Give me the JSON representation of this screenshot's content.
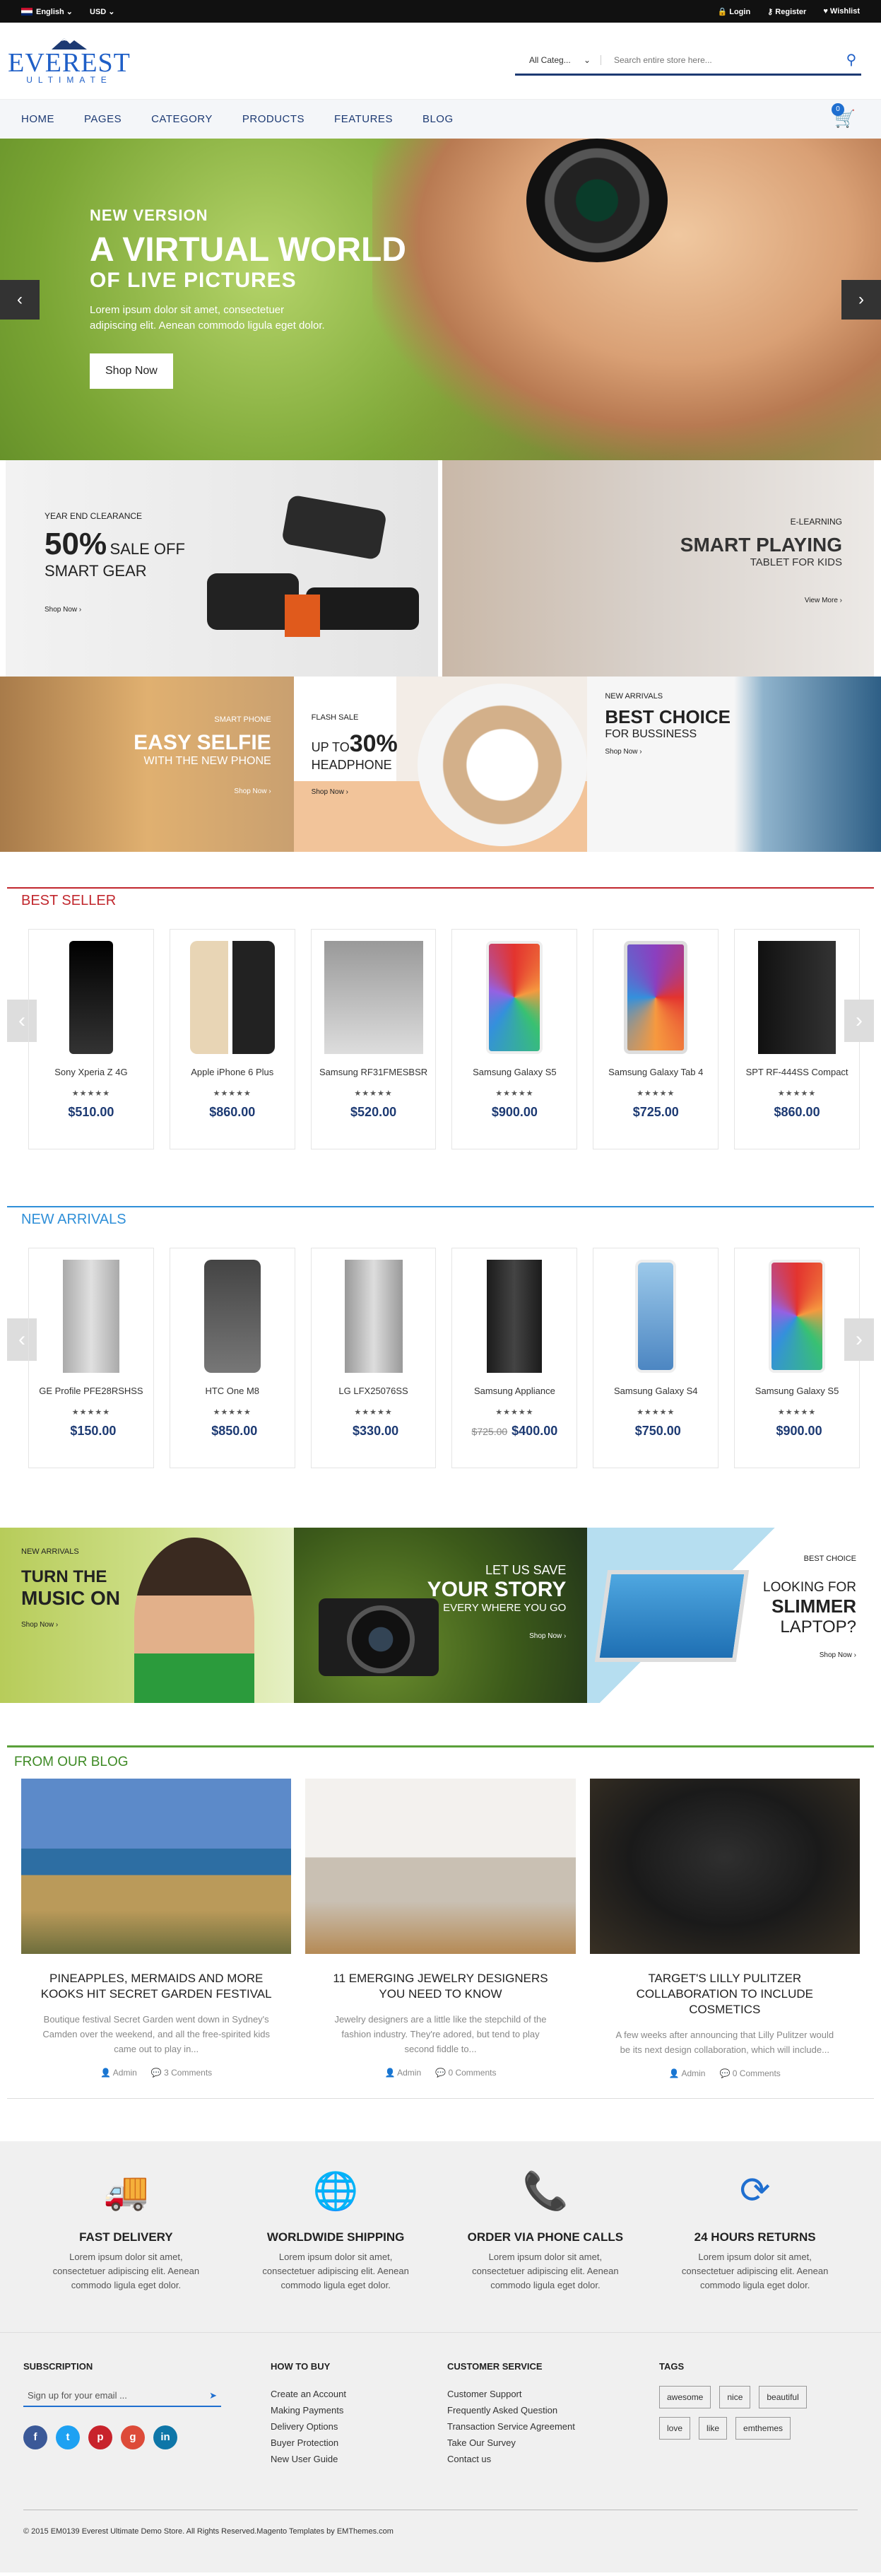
{
  "topbar": {
    "language": "English",
    "currency": "USD",
    "login": "Login",
    "register": "Register",
    "wishlist": "Wishlist"
  },
  "logo": {
    "name": "EVEREST",
    "tagline": "ULTIMATE"
  },
  "search": {
    "category": "All Categ...",
    "placeholder": "Search entire store here..."
  },
  "nav": {
    "items": [
      "HOME",
      "PAGES",
      "CATEGORY",
      "PRODUCTS",
      "FEATURES",
      "BLOG"
    ],
    "cart_count": "0"
  },
  "hero": {
    "kicker": "NEW VERSION",
    "title": "A VIRTUAL WORLD",
    "subtitle": "OF LIVE PICTURES",
    "text": "Lorem ipsum dolor sit amet, consectetuer adipiscing elit. Aenean commodo ligula eget dolor.",
    "button": "Shop Now"
  },
  "promo1": {
    "kicker": "YEAR END CLEARANCE",
    "percent": "50%",
    "sale": "SALE OFF",
    "product": "SMART GEAR",
    "shop": "Shop Now ›"
  },
  "promo2": {
    "kicker": "E-LEARNING",
    "title": "SMART PLAYING",
    "subtitle": "TABLET FOR KIDS",
    "shop": "View More ›"
  },
  "promo3": {
    "kicker": "SMART PHONE",
    "title": "EASY SELFIE",
    "subtitle": "WITH THE NEW PHONE",
    "shop": "Shop Now ›"
  },
  "promo4": {
    "kicker": "FLASH SALE",
    "upto": "UP TO",
    "percent": "30%",
    "product": "HEADPHONE",
    "shop": "Shop Now ›"
  },
  "promo5": {
    "kicker": "NEW ARRIVALS",
    "title": "BEST CHOICE",
    "subtitle": "FOR BUSSINESS",
    "shop": "Shop Now ›"
  },
  "bestseller": {
    "title": "BEST SELLER",
    "products": [
      {
        "name": "Sony Xperia Z 4G",
        "price": "$510.00",
        "stars": "★★★★★"
      },
      {
        "name": "Apple iPhone 6 Plus",
        "price": "$860.00",
        "stars": "★★★★★"
      },
      {
        "name": "Samsung RF31FMESBSR",
        "price": "$520.00",
        "stars": "★★★★★"
      },
      {
        "name": "Samsung Galaxy S5",
        "price": "$900.00",
        "stars": "★★★★★"
      },
      {
        "name": "Samsung Galaxy Tab 4",
        "price": "$725.00",
        "stars": "★★★★★"
      },
      {
        "name": "SPT RF-444SS Compact",
        "price": "$860.00",
        "stars": "★★★★★"
      }
    ]
  },
  "newarrivals": {
    "title": "NEW ARRIVALS",
    "products": [
      {
        "name": "GE Profile PFE28RSHSS",
        "price": "$150.00",
        "stars": "★★★★★",
        "old": ""
      },
      {
        "name": "HTC One M8",
        "price": "$850.00",
        "stars": "★★★★★",
        "old": ""
      },
      {
        "name": "LG LFX25076SS",
        "price": "$330.00",
        "stars": "★★★★★",
        "old": ""
      },
      {
        "name": "Samsung Appliance",
        "price": "$400.00",
        "stars": "★★★★★",
        "old": "$725.00"
      },
      {
        "name": "Samsung Galaxy S4",
        "price": "$750.00",
        "stars": "★★★★★",
        "old": ""
      },
      {
        "name": "Samsung Galaxy S5",
        "price": "$900.00",
        "stars": "★★★★★",
        "old": ""
      }
    ]
  },
  "promo6": {
    "kicker": "NEW ARRIVALS",
    "title": "TURN THE",
    "title2": "MUSIC ON",
    "shop": "Shop Now ›"
  },
  "promo7": {
    "kicker": "LET US SAVE",
    "title": "YOUR STORY",
    "subtitle": "EVERY WHERE YOU GO",
    "shop": "Shop Now ›"
  },
  "promo8": {
    "kicker": "BEST CHOICE",
    "title": "LOOKING FOR",
    "title2": "SLIMMER",
    "title3": "LAPTOP?",
    "shop": "Shop Now ›"
  },
  "blog": {
    "title": "FROM OUR BLOG",
    "posts": [
      {
        "title": "PINEAPPLES, MERMAIDS AND MORE KOOKS HIT SECRET GARDEN FESTIVAL",
        "excerpt": "Boutique festival Secret Garden went down in Sydney's Camden over the weekend, and all the free-spirited kids came out to play in...",
        "author": "Admin",
        "comments": "3 Comments"
      },
      {
        "title": "11 EMERGING JEWELRY DESIGNERS YOU NEED TO KNOW",
        "excerpt": "Jewelry designers are a little like the stepchild of the fashion industry. They're adored, but tend to play second fiddle to...",
        "author": "Admin",
        "comments": "0 Comments"
      },
      {
        "title": "TARGET'S LILLY PULITZER COLLABORATION TO INCLUDE COSMETICS",
        "excerpt": "A few weeks after announcing that Lilly Pulitzer would be its next design collaboration, which will include...",
        "author": "Admin",
        "comments": "0 Comments"
      }
    ]
  },
  "features": [
    {
      "title": "FAST DELIVERY",
      "text": "Lorem ipsum dolor sit amet, consectetuer adipiscing elit. Aenean commodo ligula eget dolor.",
      "icon": "truck-icon"
    },
    {
      "title": "WORLDWIDE SHIPPING",
      "text": "Lorem ipsum dolor sit amet, consectetuer adipiscing elit. Aenean commodo ligula eget dolor.",
      "icon": "globe-icon"
    },
    {
      "title": "ORDER VIA PHONE CALLS",
      "text": "Lorem ipsum dolor sit amet, consectetuer adipiscing elit. Aenean commodo ligula eget dolor.",
      "icon": "phone-icon"
    },
    {
      "title": "24 HOURS RETURNS",
      "text": "Lorem ipsum dolor sit amet, consectetuer adipiscing elit. Aenean commodo ligula eget dolor.",
      "icon": "24h-icon"
    }
  ],
  "footer": {
    "subscription": {
      "title": "SUBSCRIPTION",
      "placeholder": "Sign up for your email ..."
    },
    "howtobuy": {
      "title": "HOW TO BUY",
      "links": [
        "Create an Account",
        "Making Payments",
        "Delivery Options",
        "Buyer Protection",
        "New User Guide"
      ]
    },
    "service": {
      "title": "CUSTOMER SERVICE",
      "links": [
        "Customer Support",
        "Frequently Asked Question",
        "Transaction Service Agreement",
        "Take Our Survey",
        "Contact us"
      ]
    },
    "tags": {
      "title": "TAGS",
      "items": [
        "awesome",
        "nice",
        "beautiful",
        "love",
        "like",
        "emthemes"
      ]
    },
    "copyright": "© 2015 EM0139 Everest Ultimate Demo Store. All Rights Reserved.Magento Templates by EMThemes.com",
    "accent": "#1f6fd0"
  }
}
